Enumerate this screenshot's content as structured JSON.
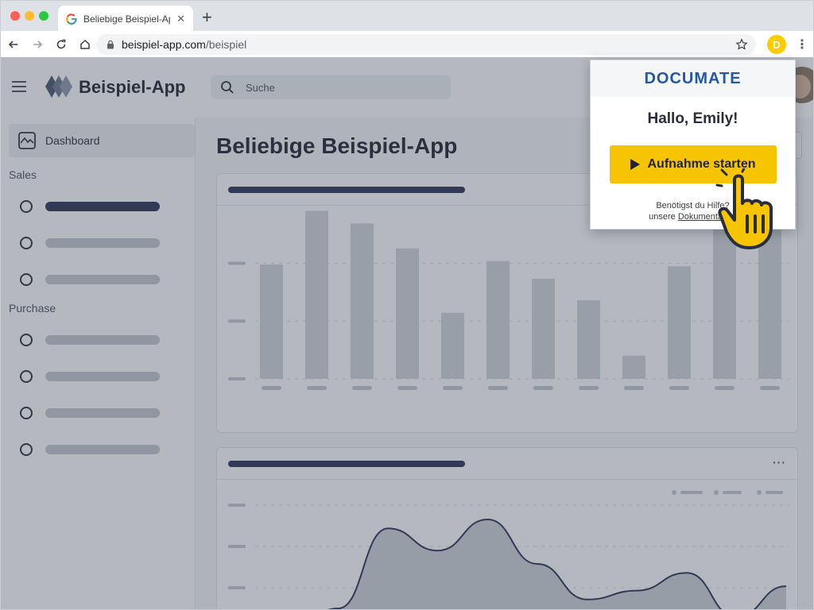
{
  "browser": {
    "tab_title": "Beliebige Beispiel-App",
    "tab_close": "✕",
    "new_tab": "+",
    "url_domain": "beispiel-app.com",
    "url_path": "/beispiel",
    "extension_letter": "D"
  },
  "app": {
    "name": "Beispiel-App",
    "search_placeholder": "Suche",
    "page_title": "Beliebige Beispiel-App"
  },
  "sidebar": {
    "active_item": "Dashboard",
    "sections": [
      {
        "title": "Sales",
        "item_count": 3
      },
      {
        "title": "Purchase",
        "item_count": 4
      }
    ]
  },
  "charts": {
    "bar_card_more": "",
    "line_card_more": "···"
  },
  "chart_data": [
    {
      "type": "bar",
      "values": [
        64,
        94,
        87,
        73,
        37,
        66,
        56,
        44,
        13,
        63,
        94,
        94
      ],
      "ylim": [
        0,
        100
      ],
      "grid": true
    },
    {
      "type": "area",
      "values": [
        0,
        20,
        92,
        72,
        100,
        60,
        28,
        36,
        52,
        12,
        40
      ],
      "ylim": [
        0,
        100
      ],
      "grid": true
    }
  ],
  "popup": {
    "brand": "DOCUMATE",
    "greeting": "Hallo, Emily!",
    "record_button": "Aufnahme starten",
    "help_line1": "Benötigst du Hilfe?",
    "help_prefix": "unsere ",
    "help_link": "Dokumentation"
  },
  "colors": {
    "accent": "#f7c400",
    "brand": "#2557a7",
    "navy": "#2a3158"
  }
}
